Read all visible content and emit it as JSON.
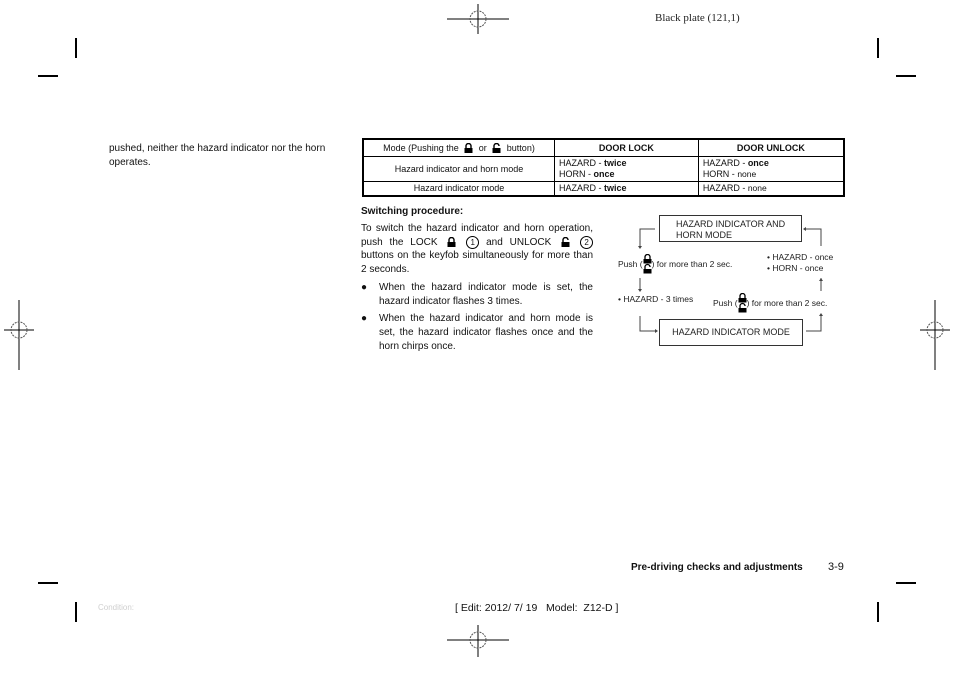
{
  "header": {
    "plate": "Black plate (121,1)"
  },
  "left_column": {
    "paragraph": "pushed, neither the hazard indicator nor the horn operates."
  },
  "mode_table": {
    "header": {
      "mode_prefix": "Mode (Pushing the",
      "mode_or": "or",
      "mode_suffix": "button)",
      "door_lock": "DOOR LOCK",
      "door_unlock": "DOOR UNLOCK"
    },
    "rows": [
      {
        "mode": "Hazard indicator and horn mode",
        "lock": [
          {
            "label": "HAZARD - ",
            "value": "twice",
            "bold": true
          },
          {
            "label": "HORN - ",
            "value": "once",
            "bold": true
          }
        ],
        "unlock": [
          {
            "label": "HAZARD - ",
            "value": "once",
            "bold": true
          },
          {
            "label": "HORN - ",
            "value": "none",
            "bold": false
          }
        ]
      },
      {
        "mode": "Hazard indicator mode",
        "lock": [
          {
            "label": "HAZARD - ",
            "value": "twice",
            "bold": true
          }
        ],
        "unlock": [
          {
            "label": "HAZARD - ",
            "value": "none",
            "bold": false
          }
        ]
      }
    ]
  },
  "switching": {
    "heading": "Switching procedure:",
    "intro_1": "To switch the hazard indicator and horn operation, push the LOCK",
    "circle_1": "1",
    "intro_2": "and UNLOCK",
    "circle_2": "2",
    "intro_3": "buttons on the keyfob simultaneously for more than 2 seconds.",
    "bullets": [
      "When the hazard indicator mode is set, the hazard indicator flashes 3 times.",
      "When the hazard indicator and horn mode is set, the hazard indicator flashes once and the horn chirps once."
    ],
    "bullet_glyph": "●"
  },
  "diagram": {
    "box_top": [
      "HAZARD INDICATOR AND",
      "HORN MODE"
    ],
    "box_bottom": "HAZARD INDICATOR MODE",
    "push_left_prefix": "Push (",
    "push_left_suffix": ") for more than 2 sec.",
    "push_right_prefix": "Push (",
    "push_right_suffix": ") for more than 2 sec.",
    "result_left": "• HAZARD - 3 times",
    "result_right": [
      "• HAZARD - once",
      "• HORN - once"
    ]
  },
  "footer": {
    "section_title": "Pre-driving checks and adjustments",
    "page_number": "3-9",
    "condition": "Condition:",
    "edit_info": "[ Edit: 2012/ 7/ 19   Model:  Z12-D ]"
  }
}
